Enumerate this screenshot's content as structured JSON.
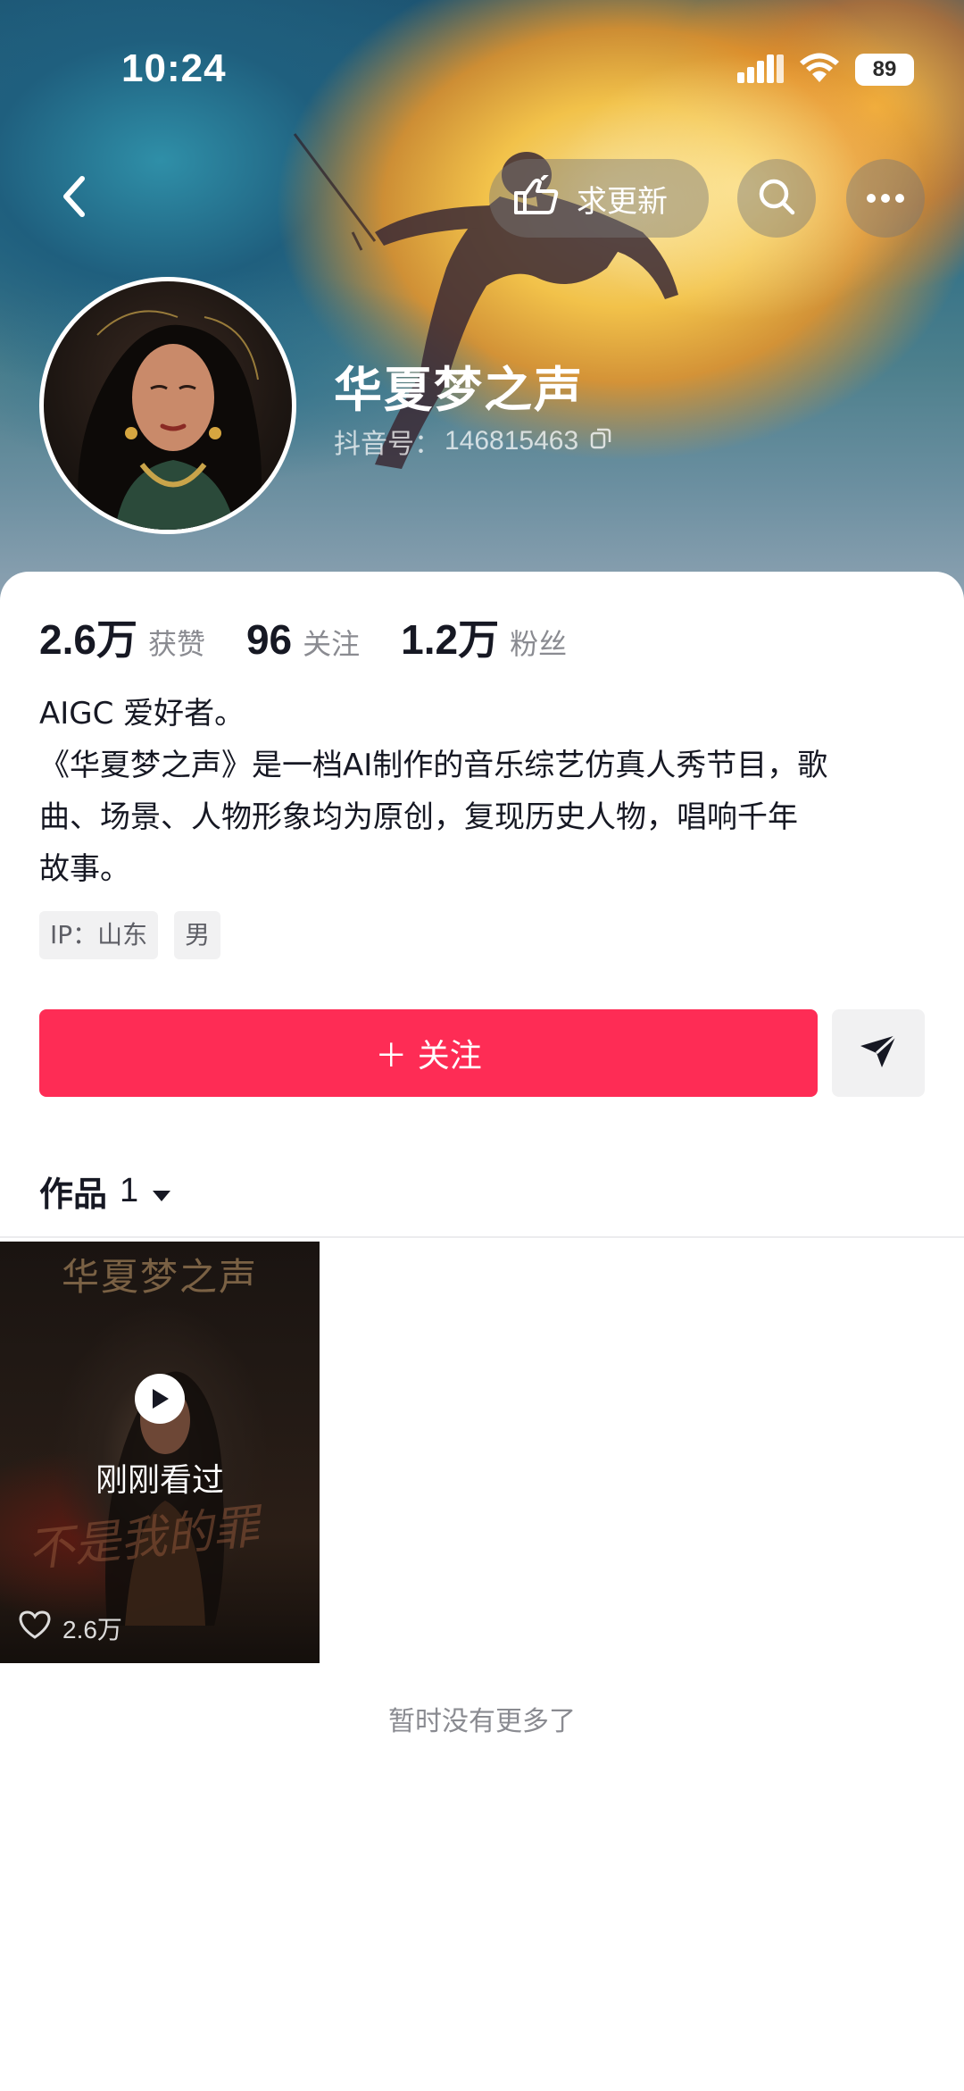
{
  "status_bar": {
    "time": "10:24",
    "battery": "89",
    "icons": [
      "signal-icon",
      "wifi-icon",
      "battery-icon"
    ]
  },
  "nav": {
    "back_icon": "back-arrow-icon",
    "request_update_label": "求更新",
    "request_update_icon": "hand-pointing-icon",
    "search_icon": "search-icon",
    "more_icon": "more-dots-icon"
  },
  "profile": {
    "name": "华夏梦之声",
    "douyin_id_label": "抖音号：",
    "douyin_id": "146815463",
    "copy_icon": "copy-icon"
  },
  "stats": [
    {
      "value": "2.6万",
      "label": "获赞"
    },
    {
      "value": "96",
      "label": "关注"
    },
    {
      "value": "1.2万",
      "label": "粉丝"
    }
  ],
  "bio": {
    "line1": "AIGC 爱好者。",
    "line2": "《华夏梦之声》是一档AI制作的音乐综艺仿真人秀节目，歌",
    "line3": "曲、场景、人物形象均为原创，复现历史人物，唱响千年",
    "line4": "故事。"
  },
  "tags": [
    "IP：山东",
    "男"
  ],
  "actions": {
    "follow_label": "＋ 关注",
    "send_icon": "send-message-icon"
  },
  "works": {
    "tab_label": "作品",
    "count": "1",
    "dropdown_icon": "caret-down-icon"
  },
  "video": {
    "title_art": "华夏梦之声",
    "subtitle_art": "不是我的罪",
    "watched_label": "刚刚看过",
    "likes": "2.6万",
    "play_icon": "play-icon",
    "heart_icon": "heart-icon"
  },
  "footer": {
    "no_more": "暂时没有更多了"
  },
  "colors": {
    "accent": "#fe2c55",
    "text_primary": "#161823",
    "text_secondary": "#8a8b91",
    "tag_bg": "#f1f1f2"
  }
}
